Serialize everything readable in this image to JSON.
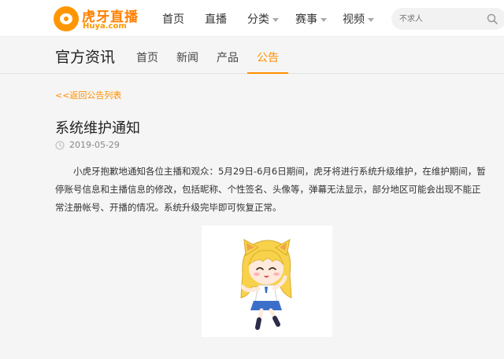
{
  "brand": {
    "name_cn": "虎牙直播",
    "name_en": "Huya.com",
    "accent": "#ff8f00"
  },
  "nav": {
    "items": [
      {
        "label": "首页"
      },
      {
        "label": "直播"
      },
      {
        "label": "分类",
        "dropdown": true
      },
      {
        "label": "赛事",
        "dropdown": true
      },
      {
        "label": "视频",
        "dropdown": true
      }
    ]
  },
  "search": {
    "placeholder": "不求人",
    "icon": "search-icon"
  },
  "section": {
    "title": "官方资讯",
    "tabs": [
      {
        "label": "首页"
      },
      {
        "label": "新闻"
      },
      {
        "label": "产品"
      },
      {
        "label": "公告",
        "active": true
      }
    ]
  },
  "article": {
    "back_label": "<<返回公告列表",
    "title": "系统维护通知",
    "date": "2019-05-29",
    "body": "小虎牙抱歉地通知各位主播和观众：5月29日-6月6日期间，虎牙将进行系统升级维护，在维护期间，暂停账号信息和主播信息的修改，包括昵称、个性签名、头像等，弹幕无法显示，部分地区可能会出现不能正常注册帐号、开播的情况。系统升级完毕即可恢复正常。",
    "image_icon": "mascot-illustration"
  }
}
